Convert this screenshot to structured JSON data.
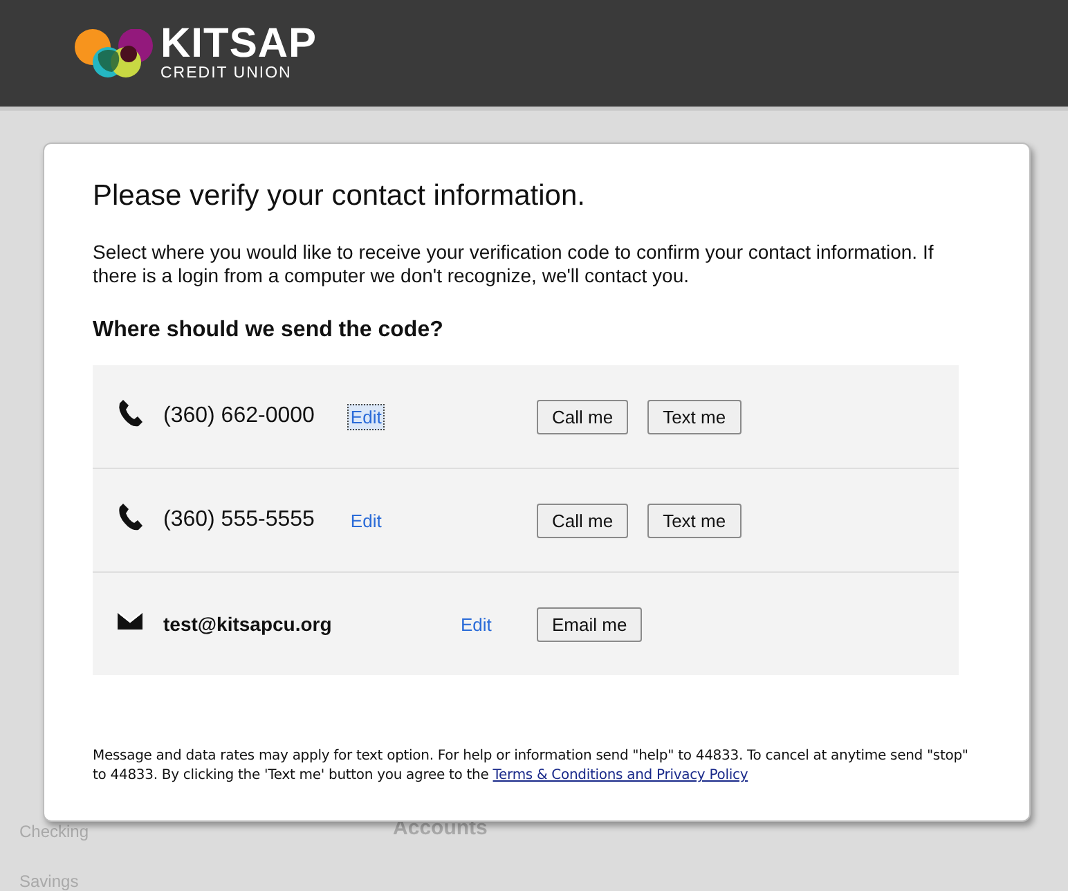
{
  "header": {
    "brand": "KITSAP",
    "subtitle": "CREDIT UNION"
  },
  "background": {
    "items": [
      "Checking",
      "Savings"
    ],
    "heading": "Accounts"
  },
  "dialog": {
    "title": "Please verify your contact information.",
    "description": "Select where you would like to receive your verification code to confirm your contact information. If there is a login from a computer we don't recognize, we'll contact you.",
    "question": "Where should we send the code?",
    "options": [
      {
        "kind": "phone",
        "value": "(360) 662-0000",
        "edit": {
          "label": "Edit",
          "focused": true
        },
        "buttons": [
          "Call me",
          "Text me"
        ]
      },
      {
        "kind": "phone",
        "value": "(360) 555-5555",
        "edit": {
          "label": "Edit",
          "focused": false
        },
        "buttons": [
          "Call me",
          "Text me"
        ]
      },
      {
        "kind": "email",
        "value": "test@kitsapcu.org",
        "edit": {
          "label": "Edit",
          "focused": false
        },
        "buttons": [
          "Email me"
        ]
      }
    ],
    "disclaimer": "Message and data rates may apply for text option. For help or information send \"help\" to 44833. To cancel at anytime send \"stop\" to 44833. By clicking the 'Text me' button you agree to the ",
    "disclaimer_link": "Terms & Conditions and Privacy Policy"
  }
}
